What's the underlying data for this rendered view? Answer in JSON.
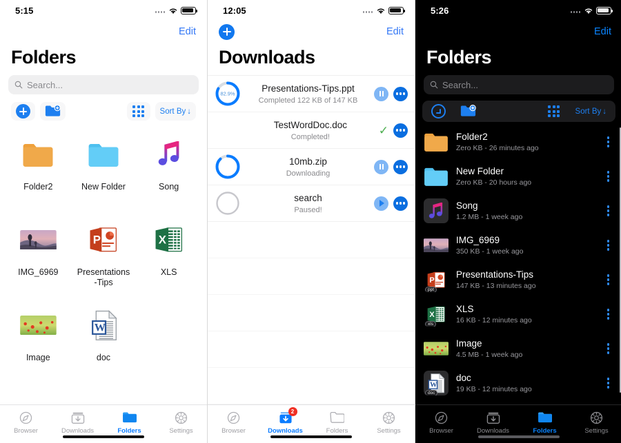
{
  "panels": [
    {
      "id": "folders-light",
      "theme": "light",
      "status": {
        "time": "5:15"
      },
      "nav": {
        "edit": "Edit"
      },
      "title": "Folders",
      "search": {
        "placeholder": "Search..."
      },
      "toolbar": {
        "sort_label": "Sort By"
      },
      "grid_items": [
        {
          "name": "Folder2",
          "icon": "folder-orange"
        },
        {
          "name": "New Folder",
          "icon": "folder-blue"
        },
        {
          "name": "Song",
          "icon": "music-note"
        },
        {
          "name": "IMG_6969",
          "icon": "photo-sunset"
        },
        {
          "name": "Presentations\n-Tips",
          "icon": "powerpoint"
        },
        {
          "name": "XLS",
          "icon": "excel"
        },
        {
          "name": "Image",
          "icon": "photo-poppies"
        },
        {
          "name": "doc",
          "icon": "word-doc"
        }
      ],
      "tabs": [
        {
          "label": "Browser",
          "icon": "compass-icon",
          "active": false
        },
        {
          "label": "Downloads",
          "icon": "download-icon",
          "active": false
        },
        {
          "label": "Folders",
          "icon": "folder-icon",
          "active": true
        },
        {
          "label": "Settings",
          "icon": "gear-icon",
          "active": false
        }
      ]
    },
    {
      "id": "downloads-light",
      "theme": "light",
      "status": {
        "time": "12:05"
      },
      "nav": {
        "edit": "Edit"
      },
      "title": "Downloads",
      "rows": [
        {
          "title": "Presentations-Tips.ppt",
          "sub": "Completed 122 KB of 147 KB",
          "ring": {
            "percent": 82.9,
            "label": "82.9%",
            "style": "labeled"
          },
          "actions": [
            "pause",
            "more"
          ]
        },
        {
          "title": "TestWordDoc.doc",
          "sub": "Completed!",
          "ring": {
            "percent": 100,
            "label": "",
            "style": "none"
          },
          "actions": [
            "check",
            "more"
          ]
        },
        {
          "title": "10mb.zip",
          "sub": "Downloading",
          "ring": {
            "percent": 88,
            "label": "",
            "style": "plain"
          },
          "actions": [
            "pause",
            "more"
          ]
        },
        {
          "title": "search",
          "sub": "Paused!",
          "ring": {
            "percent": 0,
            "label": "",
            "style": "empty"
          },
          "actions": [
            "play",
            "more"
          ]
        }
      ],
      "empty_rows": 5,
      "tabs": [
        {
          "label": "Browser",
          "icon": "compass-icon",
          "active": false,
          "badge": ""
        },
        {
          "label": "Downloads",
          "icon": "download-icon",
          "active": true,
          "badge": "2"
        },
        {
          "label": "Folders",
          "icon": "folder-icon",
          "active": false,
          "badge": ""
        },
        {
          "label": "Settings",
          "icon": "gear-icon",
          "active": false,
          "badge": ""
        }
      ]
    },
    {
      "id": "folders-dark",
      "theme": "dark",
      "status": {
        "time": "5:26"
      },
      "nav": {
        "edit": "Edit"
      },
      "title": "Folders",
      "search": {
        "placeholder": "Search..."
      },
      "toolbar": {
        "sort_label": "Sort By"
      },
      "list_items": [
        {
          "name": "Folder2",
          "meta": "Zero KB - 26 minutes ago",
          "icon": "folder-orange",
          "ext": ""
        },
        {
          "name": "New Folder",
          "meta": "Zero KB - 20 hours ago",
          "icon": "folder-blue",
          "ext": ""
        },
        {
          "name": "Song",
          "meta": "1.2 MB - 1 week ago",
          "icon": "music-note",
          "ext": ""
        },
        {
          "name": "IMG_6969",
          "meta": "350 KB - 1 week ago",
          "icon": "photo-sunset",
          "ext": ""
        },
        {
          "name": "Presentations-Tips",
          "meta": "147 KB - 13 minutes ago",
          "icon": "powerpoint",
          "ext": "ppt"
        },
        {
          "name": "XLS",
          "meta": "16 KB - 12 minutes ago",
          "icon": "excel",
          "ext": "xls"
        },
        {
          "name": "Image",
          "meta": "4.5 MB - 1 week ago",
          "icon": "photo-poppies",
          "ext": ""
        },
        {
          "name": "doc",
          "meta": "19 KB - 12 minutes ago",
          "icon": "word-doc",
          "ext": "doc"
        }
      ],
      "tabs": [
        {
          "label": "Browser",
          "icon": "compass-icon",
          "active": false
        },
        {
          "label": "Downloads",
          "icon": "download-icon",
          "active": false
        },
        {
          "label": "Folders",
          "icon": "folder-icon",
          "active": true
        },
        {
          "label": "Settings",
          "icon": "gear-icon",
          "active": false
        }
      ]
    }
  ],
  "colors": {
    "accent_blue": "#0a7cff",
    "folder_orange": "#f0a33c",
    "folder_blue": "#5ac8f5",
    "powerpoint_red": "#d04423",
    "excel_green": "#1e7145",
    "word_blue": "#2b579a",
    "badge_red": "#f03024",
    "check_green": "#4cae4f"
  }
}
